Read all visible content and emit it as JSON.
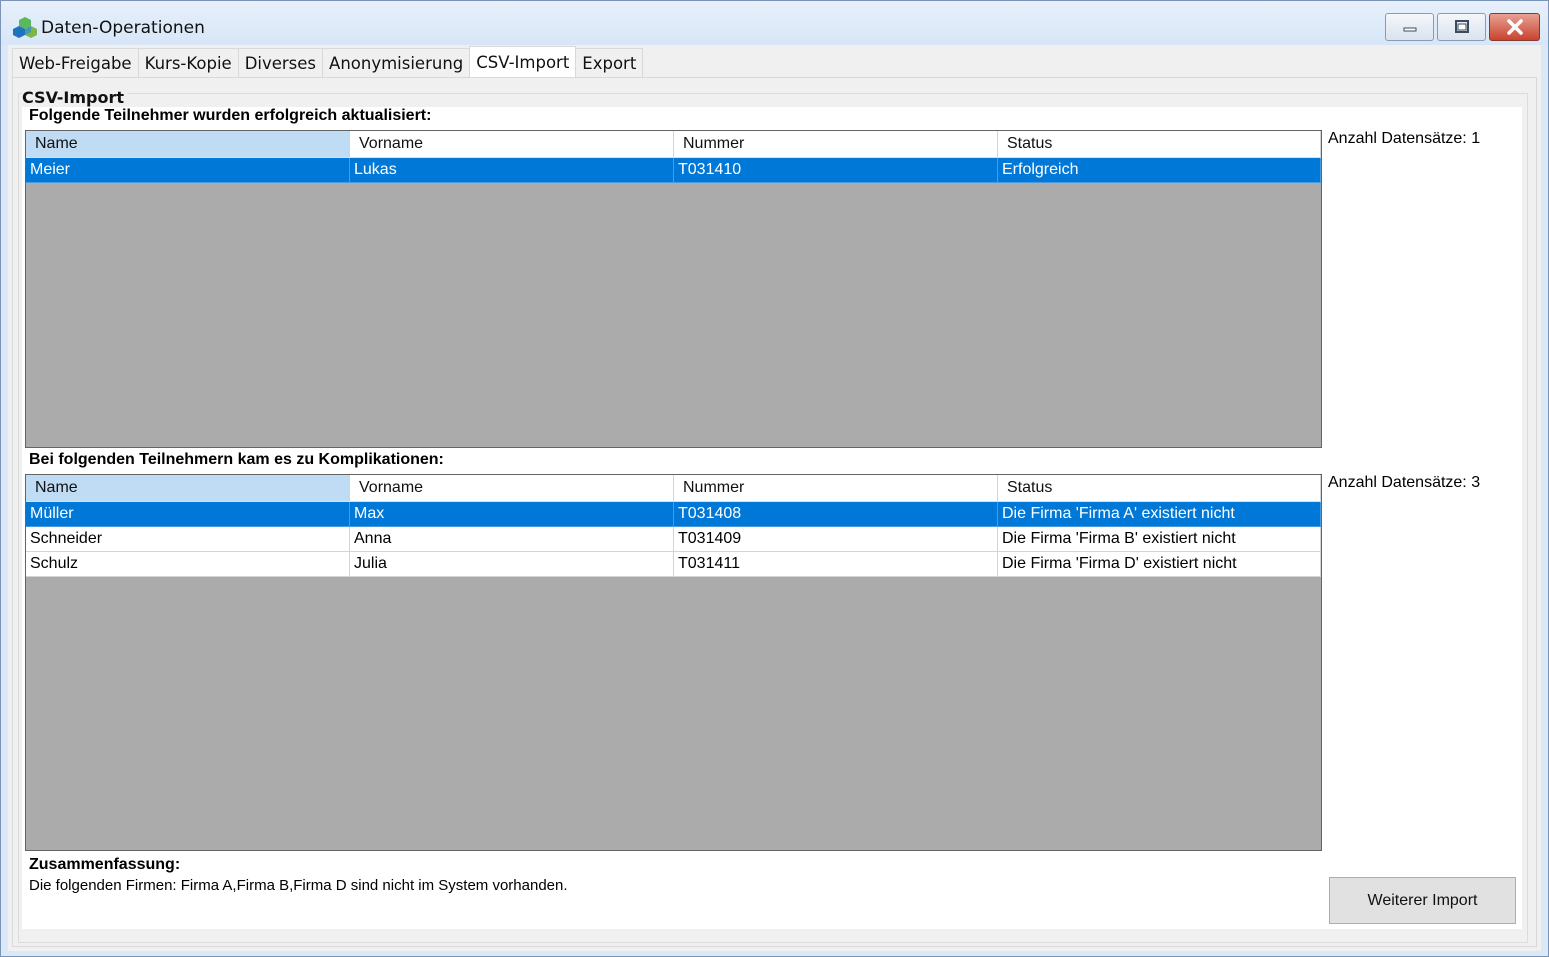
{
  "window": {
    "title": "Daten-Operationen",
    "icon": "app-cubes-icon"
  },
  "tabs": [
    {
      "label": "Web-Freigabe",
      "active": false
    },
    {
      "label": "Kurs-Kopie",
      "active": false
    },
    {
      "label": "Diverses",
      "active": false
    },
    {
      "label": "Anonymisierung",
      "active": false
    },
    {
      "label": "CSV-Import",
      "active": true
    },
    {
      "label": "Export",
      "active": false
    }
  ],
  "group": {
    "title": "CSV-Import"
  },
  "success": {
    "label": "Folgende Teilnehmer wurden erfolgreich aktualisiert:",
    "count_label": "Anzahl Datensätze: 1",
    "columns": [
      "Name",
      "Vorname",
      "Nummer",
      "Status"
    ],
    "rows": [
      [
        "Meier",
        "Lukas",
        "T031410",
        "Erfolgreich"
      ]
    ]
  },
  "problems": {
    "label": "Bei folgenden Teilnehmern kam es zu Komplikationen:",
    "count_label": "Anzahl Datensätze: 3",
    "columns": [
      "Name",
      "Vorname",
      "Nummer",
      "Status"
    ],
    "rows": [
      [
        "Müller",
        "Max",
        "T031408",
        "Die Firma 'Firma A' existiert nicht"
      ],
      [
        "Schneider",
        "Anna",
        "T031409",
        "Die Firma 'Firma B' existiert nicht"
      ],
      [
        "Schulz",
        "Julia",
        "T031411",
        "Die Firma 'Firma D' existiert nicht"
      ]
    ]
  },
  "summary": {
    "title": "Zusammenfassung:",
    "text": "Die folgenden Firmen: Firma A,Firma B,Firma D sind nicht im System vorhanden."
  },
  "buttons": {
    "import_label": "Weiterer Import"
  },
  "colors": {
    "selection": "#0078d7",
    "header_selected": "#bfdcf4",
    "grid_background": "#ababab"
  }
}
